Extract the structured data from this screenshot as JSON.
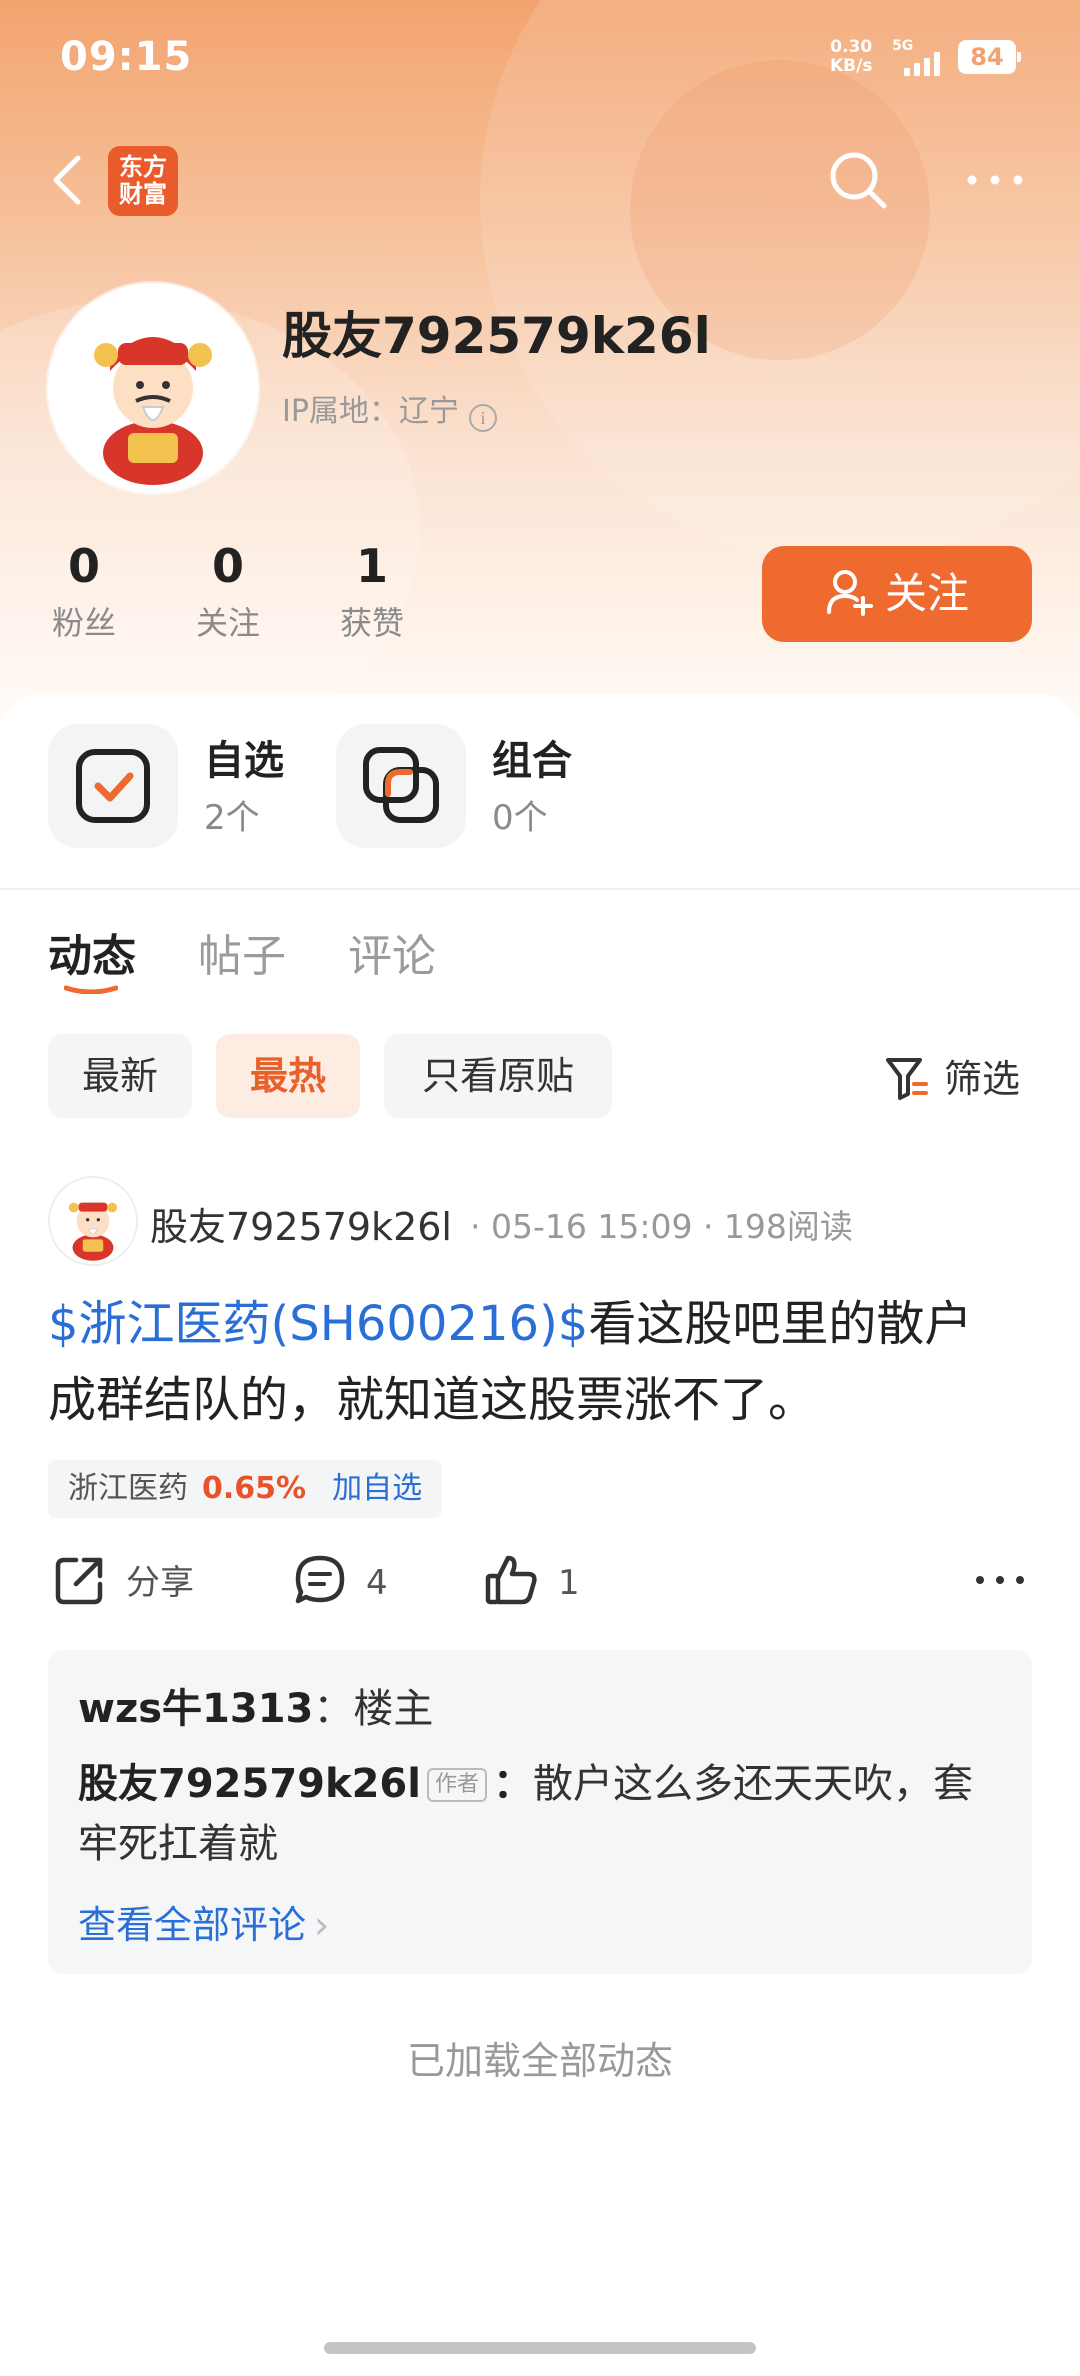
{
  "status_bar": {
    "time": "09:15",
    "net_speed_value": "0.30",
    "net_speed_unit": "KB/s",
    "network": "5G",
    "battery": "84"
  },
  "nav": {
    "logo_line1": "东方",
    "logo_line2": "财富",
    "back_icon": "chevron-left-icon",
    "search_icon": "search-icon",
    "more_icon": "more-horizontal-icon"
  },
  "profile": {
    "username": "股友792579k26l",
    "ip_location": "IP属地：辽宁",
    "stats": [
      {
        "value": "0",
        "label": "粉丝"
      },
      {
        "value": "0",
        "label": "关注"
      },
      {
        "value": "1",
        "label": "获赞"
      }
    ],
    "follow_label": "关注"
  },
  "cards": [
    {
      "title": "自选",
      "sub": "2个",
      "icon": "checkbox-icon"
    },
    {
      "title": "组合",
      "sub": "0个",
      "icon": "overlap-squares-icon"
    }
  ],
  "tabs": [
    "动态",
    "帖子",
    "评论"
  ],
  "active_tab": "动态",
  "filters": {
    "chips": [
      "最新",
      "最热",
      "只看原贴"
    ],
    "active": "最热",
    "filter_label": "筛选"
  },
  "post": {
    "author": "股友792579k26l",
    "meta": "· 05-16 15:09 · 198阅读",
    "stock_link": "$浙江医药(SH600216)$",
    "text_line1": "看这股吧里的散户",
    "text_line2": "成群结队的，就知道这股票涨不了。",
    "tag": {
      "name": "浙江医药",
      "change": "0.65%",
      "add": "加自选"
    },
    "actions": {
      "share": "分享",
      "comments": "4",
      "likes": "1"
    }
  },
  "comments": {
    "reply_user": "wzs牛1313",
    "reply_sep": "：",
    "reply_text": "楼主",
    "op_user": "股友792579k26l",
    "op_badge": "作者",
    "op_sep": "：",
    "op_text": "散户这么多还天天吹，套牢死扛着就",
    "view_all": "查看全部评论"
  },
  "end_note": "已加载全部动态",
  "colors": {
    "accent": "#ef6a2f",
    "link": "#2a6fd6",
    "up": "#e8532a"
  }
}
